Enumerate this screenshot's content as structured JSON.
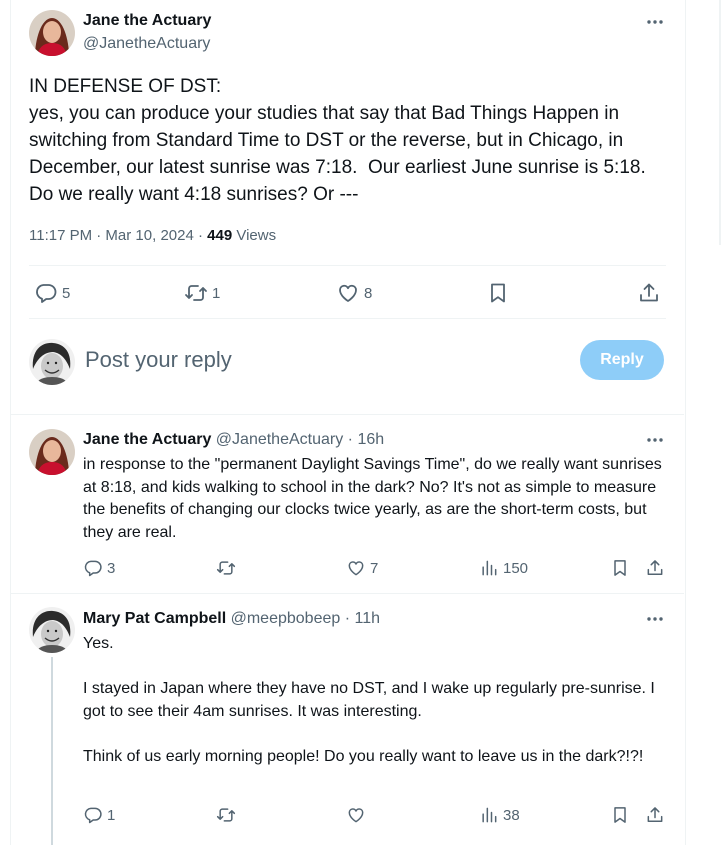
{
  "main_tweet": {
    "author": "Jane the Actuary",
    "handle": "@JanetheActuary",
    "text": "IN DEFENSE OF DST:\nyes, you can produce your studies that say that Bad Things Happen in switching from Standard Time to DST or the reverse, but in Chicago, in December, our latest sunrise was 7:18.  Our earliest June sunrise is 5:18.  Do we really want 4:18 sunrises? Or ---",
    "time": "11:17 PM · Mar 10, 2024 · ",
    "views_count": "449",
    "views_label": " Views",
    "stats": {
      "replies": "5",
      "reposts": "1",
      "likes": "8"
    }
  },
  "compose": {
    "placeholder": "Post your reply",
    "button": "Reply"
  },
  "replies": [
    {
      "author": "Jane the Actuary",
      "handle": "@JanetheActuary · 16h",
      "text": "in response to the \"permanent Daylight Savings Time\", do we really want sunrises at 8:18, and kids walking to school in the dark? No? It's not as simple to measure the benefits of changing our clocks twice yearly, as are the short-term costs, but they are real.",
      "stats": {
        "replies": "3",
        "reposts": "",
        "likes": "7",
        "views": "150"
      }
    },
    {
      "author": "Mary Pat Campbell",
      "handle": "@meepbobeep · 11h",
      "text": "Yes.\n\nI stayed in Japan where they have no DST, and I wake up regularly pre-sunrise. I got to see their 4am sunrises. It was interesting.\n\nThink of us early morning people! Do you really want to leave us in the dark?!?!",
      "stats": {
        "replies": "1",
        "reposts": "",
        "likes": "",
        "views": "38"
      }
    }
  ],
  "colors": {
    "accent": "#1d9bf0",
    "reply_button_disabled": "#8ecdf8",
    "secondary_text": "#536471"
  },
  "icons": [
    "reply-icon",
    "repost-icon",
    "like-icon",
    "bookmark-icon",
    "share-icon",
    "views-icon",
    "more-icon"
  ]
}
